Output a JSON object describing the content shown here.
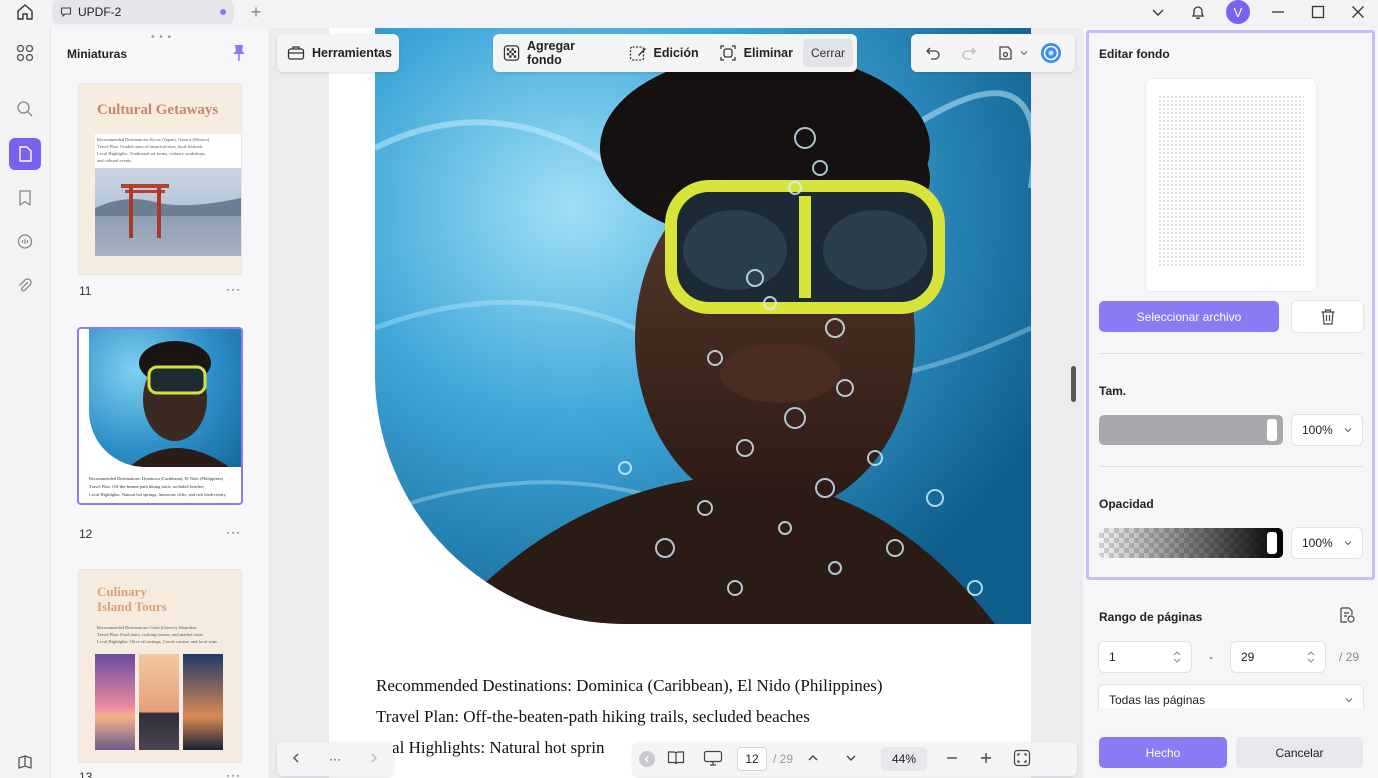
{
  "titlebar": {
    "tab_label": "UPDF-2",
    "avatar_initial": "V"
  },
  "thumbnails": {
    "title": "Miniaturas",
    "more": "···",
    "pages": [
      {
        "number": "11",
        "title": "Cultural Getaways",
        "lines": [
          "Recommended Destinations: Kyoto (Japan), Oaxaca (Mexico)",
          "Travel Plan: Guided tours of historical sites, local festivals",
          "Local Highlights: Traditional art forms, culinary workshops,",
          "and cultural events"
        ]
      },
      {
        "number": "12",
        "lines": [
          "Recommended Destinations: Dominica (Caribbean), El Nido (Philippines)",
          "Travel Plan: Off-the-beaten-path hiking trails, secluded beaches",
          "Local Highlights: Natural hot springs, limestone cliffs, and rich biodiversity"
        ]
      },
      {
        "number": "13",
        "title_line1": "Culinary",
        "title_line2": "Island Tours",
        "lines": [
          "Recommended Destinations: Crete (Greece), Mauritius",
          "Travel Plan: Food tours, cooking classes, and market visits",
          "Local Highlights: Olive oil tastings, Creole cuisine, and local wine"
        ]
      }
    ]
  },
  "toolbar": {
    "tools_label": "Herramientas",
    "add_bg_label": "Agregar fondo",
    "edit_label": "Edición",
    "delete_label": "Eliminar",
    "close_label": "Cerrar"
  },
  "document": {
    "lines": [
      "Recommended Destinations: Dominica (Caribbean), El Nido (Philippines)",
      "Travel Plan: Off-the-beaten-path hiking trails, secluded beaches",
      "ocal Highlights: Natural hot sprin"
    ]
  },
  "bottom": {
    "more": "···",
    "page_current": "12",
    "page_total": "/ 29",
    "zoom": "44%"
  },
  "right_panel": {
    "edit_title": "Editar fondo",
    "select_file": "Seleccionar archivo",
    "size_label": "Tam.",
    "size_value": "100%",
    "size_level": 1.0,
    "opacity_label": "Opacidad",
    "opacity_value": "100%",
    "opacity_level": 1.0,
    "range_label": "Rango de páginas",
    "range_from": "1",
    "range_dash": "-",
    "range_to": "29",
    "range_total": "/ 29",
    "range_mode": "Todas las páginas",
    "done": "Hecho",
    "cancel": "Cancelar"
  },
  "colors": {
    "accent": "#8a7bf5",
    "accent_border": "#c5bdf7"
  }
}
